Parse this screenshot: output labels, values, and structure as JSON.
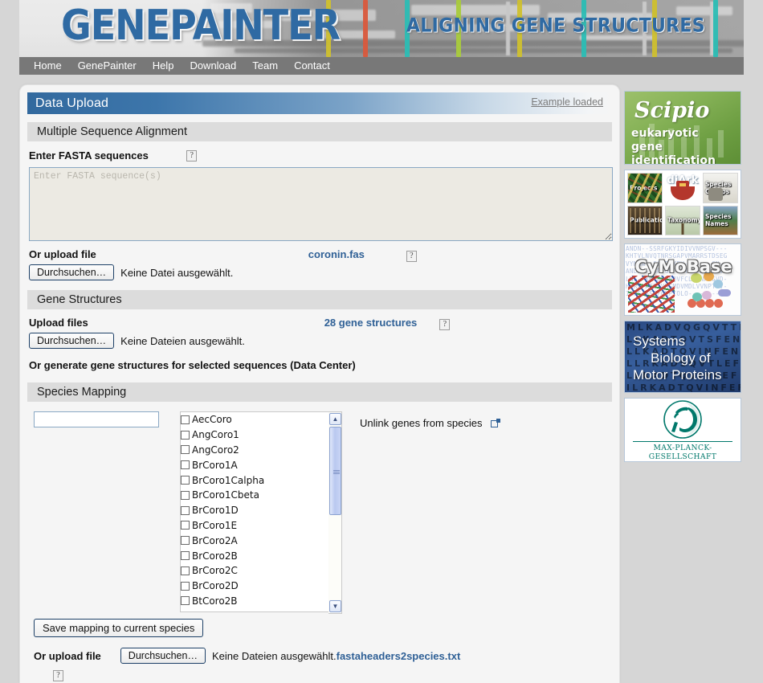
{
  "banner": {
    "logo": "GENEPAINTER",
    "tagline": "ALIGNING GENE STRUCTURES"
  },
  "nav": {
    "items": [
      {
        "label": "Home"
      },
      {
        "label": "GenePainter"
      },
      {
        "label": "Help"
      },
      {
        "label": "Download"
      },
      {
        "label": "Team"
      },
      {
        "label": "Contact"
      }
    ]
  },
  "panel": {
    "title": "Data Upload",
    "example_link": "Example loaded",
    "help_icon": "?"
  },
  "msa": {
    "section_title": "Multiple Sequence Alignment",
    "fasta_label": "Enter FASTA sequences",
    "fasta_value": "",
    "fasta_placeholder": "Enter FASTA sequence(s)",
    "upload_label": "Or upload file",
    "browse_button": "Durchsuchen…",
    "file_status": "Keine Datei ausgewählt.",
    "loaded_file": "coronin.fas"
  },
  "gene_structures": {
    "section_title": "Gene Structures",
    "upload_label": "Upload files",
    "browse_button": "Durchsuchen…",
    "file_status": "Keine Dateien ausgewählt.",
    "loaded_info": "28 gene structures",
    "generate_label": "Or generate gene structures for selected sequences (Data Center)"
  },
  "species_mapping": {
    "section_title": "Species Mapping",
    "search_value": "",
    "search_placeholder": "",
    "unlink_label": "Unlink genes from species",
    "save_button": "Save mapping to current species",
    "upload_label": "Or upload file",
    "browse_button": "Durchsuchen…",
    "file_status": "Keine Dateien ausgewählt.",
    "loaded_file": "fastaheaders2species.txt",
    "species": [
      "AecCoro",
      "AngCoro1",
      "AngCoro2",
      "BrCoro1A",
      "BrCoro1Calpha",
      "BrCoro1Cbeta",
      "BrCoro1D",
      "BrCoro1E",
      "BrCoro2A",
      "BrCoro2B",
      "BrCoro2C",
      "BrCoro2D",
      "BtCoro2B"
    ]
  },
  "sidebar": {
    "scipio": {
      "name": "Scipio",
      "line1": "eukaryotic",
      "line2": "gene identification"
    },
    "diark": {
      "name": "diArk",
      "tiles": [
        "Projects",
        "Species Groups",
        "Publications",
        "Taxonomy",
        "Species Names"
      ]
    },
    "cymobase": {
      "name": "CyMoBase",
      "seq_lines": "ANDN--SSRFGKYIDIVVNPSGV---\nKHTVLNVQTNRSGAPVMARRSTDSEG\nVYNNN--SSRPGKFV-------GN--\nANDN--SSRFGKPVET---YFSAVVG\nLNG--KMTASRNQVFCLVVNPSGVD-\nHSRS-ATRIVHGMDVMDLVVNPTGV-\nISRS-SSRFGKPIOLO-----------"
    },
    "sysbio": {
      "line1": "Systems",
      "line2": "Biology of",
      "line3": "Motor Proteins",
      "seq_lines": "MLKADVQGQVTTFE\nLLKADTQVTSFEN\nLLKADTQVINFEN\nLLRKADSQVTLEFY\nLLKADTQVINFEF\nILRKADTQVINFEF"
    },
    "mpg": {
      "name": "MAX-PLANCK-GESELLSCHAFT"
    }
  },
  "colors": {
    "accent_blue": "#2f6096",
    "title_blue": "#32699e",
    "nav_gray": "#787878",
    "page_bg": "#d6d6d6",
    "panel_bg": "#f5f5f5",
    "section_bg": "#dcdcdc",
    "scipio_green": "#6d9e42",
    "mpg_teal": "#00786b"
  }
}
